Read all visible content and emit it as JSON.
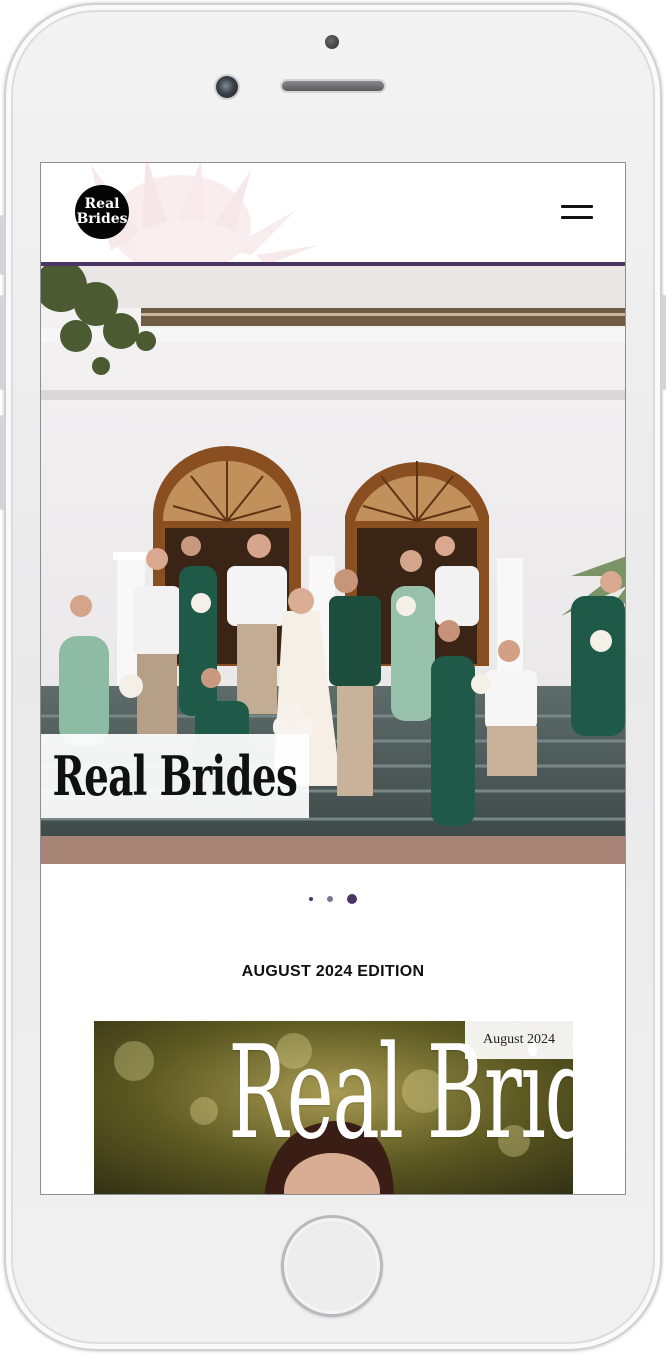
{
  "site": {
    "logo_line1": "Real",
    "logo_line2": "Brides"
  },
  "hero": {
    "title": "Real Brides",
    "slide_count": 3,
    "active_slide": 3
  },
  "edition": {
    "heading": "AUGUST 2024 EDITION",
    "cover_title": "Real Brides",
    "cover_date": "August 2024"
  },
  "colors": {
    "accent": "#4a3466",
    "header_rule": "#4a3466",
    "logo_bg": "#050505"
  },
  "icons": {
    "menu": "hamburger-icon"
  }
}
